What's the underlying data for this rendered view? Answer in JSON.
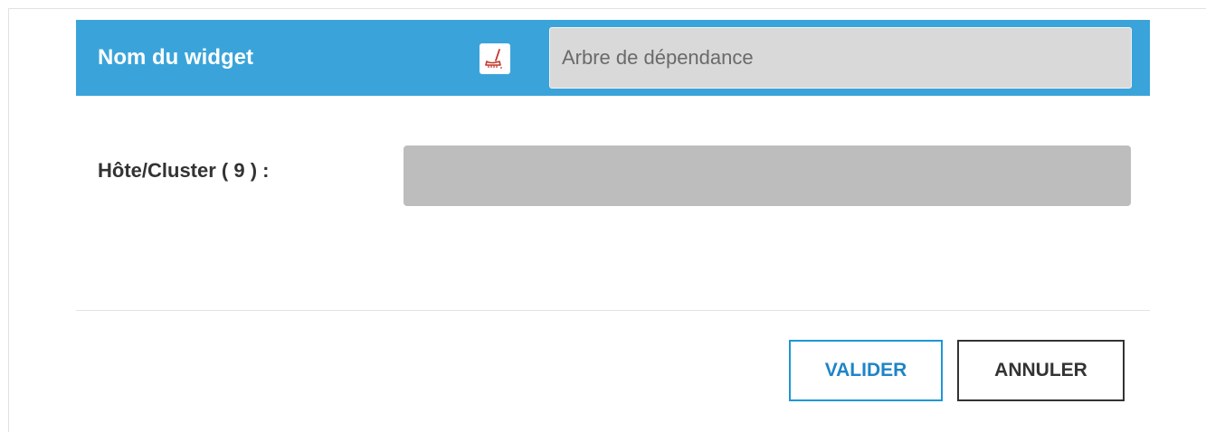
{
  "widget": {
    "name_label": "Nom du widget",
    "clear_icon": "broom-icon",
    "name_placeholder": "Arbre de dépendance",
    "name_value": ""
  },
  "form": {
    "host_label": "Hôte/Cluster ( 9 ) :",
    "host_value": ""
  },
  "actions": {
    "validate_label": "VALIDER",
    "cancel_label": "ANNULER"
  },
  "colors": {
    "header_bg": "#3aa4da",
    "primary": "#1e96d7",
    "icon_red": "#c0392b"
  }
}
